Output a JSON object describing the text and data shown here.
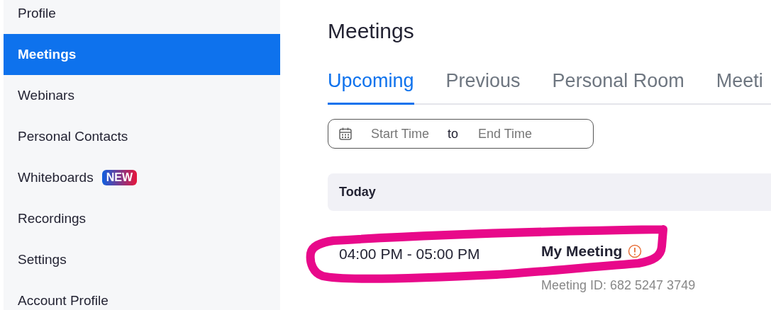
{
  "sidebar": {
    "items": [
      {
        "label": "Profile",
        "selected": false
      },
      {
        "label": "Meetings",
        "selected": true
      },
      {
        "label": "Webinars",
        "selected": false
      },
      {
        "label": "Personal Contacts",
        "selected": false
      },
      {
        "label": "Whiteboards",
        "selected": false,
        "badge": "NEW"
      },
      {
        "label": "Recordings",
        "selected": false
      },
      {
        "label": "Settings",
        "selected": false
      },
      {
        "label": "Account Profile",
        "selected": false
      }
    ]
  },
  "page_title": "Meetings",
  "tabs": [
    {
      "label": "Upcoming",
      "selected": true
    },
    {
      "label": "Previous",
      "selected": false
    },
    {
      "label": "Personal Room",
      "selected": false
    },
    {
      "label": "Meeti",
      "selected": false
    }
  ],
  "date_range": {
    "start_placeholder": "Start Time",
    "separator": "to",
    "end_placeholder": "End Time"
  },
  "groups": [
    {
      "heading": "Today",
      "meetings": [
        {
          "time": "04:00 PM - 05:00 PM",
          "title": "My Meeting",
          "warning": true,
          "meeting_id": "Meeting ID: 682 5247 3749"
        }
      ]
    }
  ]
}
